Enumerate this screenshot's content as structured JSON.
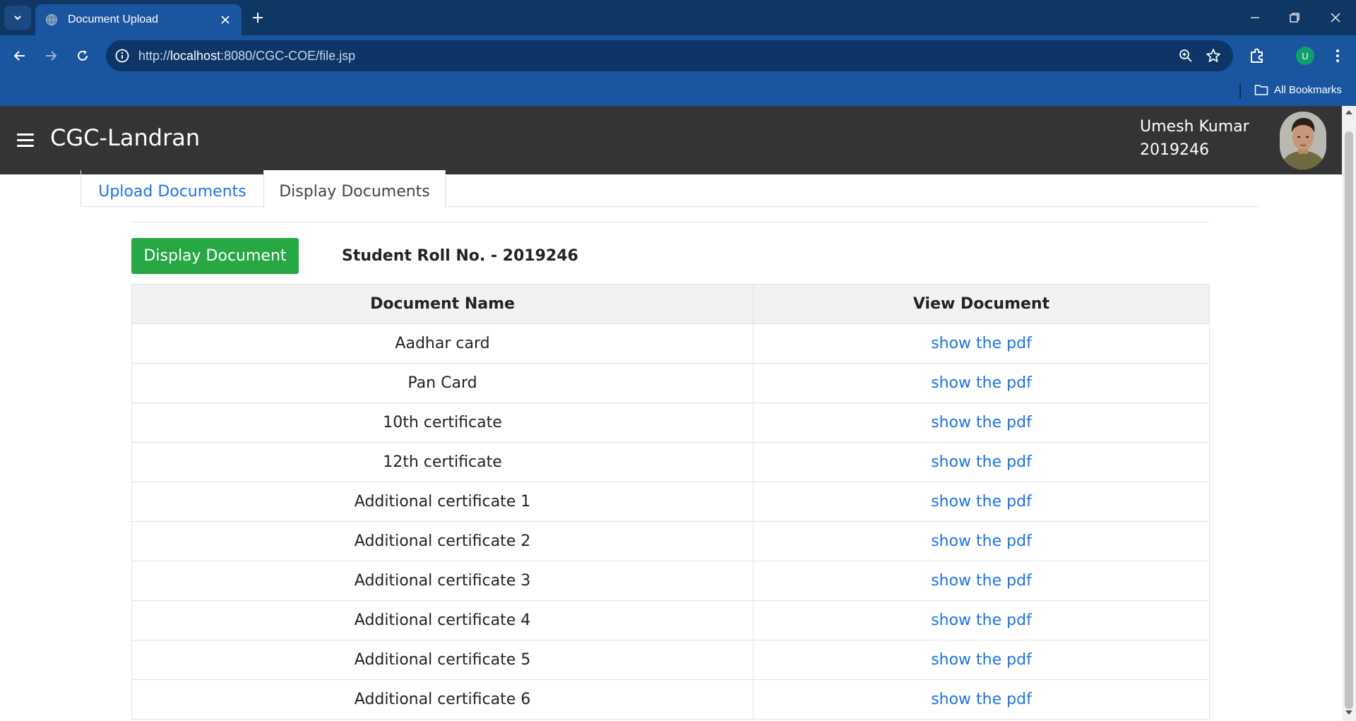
{
  "browser": {
    "tab_title": "Document Upload",
    "url_prefix": "http://",
    "url_host": "localhost",
    "url_rest": ":8080/CGC-COE/file.jsp",
    "profile_initial": "U",
    "bookmarks_label": "All Bookmarks"
  },
  "app": {
    "brand": "CGC-Landran",
    "user_name": "Umesh Kumar",
    "user_id": "2019246"
  },
  "tabs": {
    "upload": "Upload Documents",
    "display": "Display Documents"
  },
  "panel": {
    "button_label": "Display Document",
    "roll_label": "Student Roll No. - 2019246"
  },
  "table": {
    "headers": [
      "Document Name",
      "View Document"
    ],
    "rows": [
      {
        "name": "Aadhar card",
        "link": "show the pdf"
      },
      {
        "name": "Pan Card",
        "link": "show the pdf"
      },
      {
        "name": "10th certificate",
        "link": "show the pdf"
      },
      {
        "name": "12th certificate",
        "link": "show the pdf"
      },
      {
        "name": "Additional certificate 1",
        "link": "show the pdf"
      },
      {
        "name": "Additional certificate 2",
        "link": "show the pdf"
      },
      {
        "name": "Additional certificate 3",
        "link": "show the pdf"
      },
      {
        "name": "Additional certificate 4",
        "link": "show the pdf"
      },
      {
        "name": "Additional certificate 5",
        "link": "show the pdf"
      },
      {
        "name": "Additional certificate 6",
        "link": "show the pdf"
      }
    ]
  },
  "colors": {
    "appbar": "#343434",
    "chrome_dark": "#0f3764",
    "chrome": "#1a55a0",
    "success": "#28a745",
    "link": "#1a73e8"
  }
}
